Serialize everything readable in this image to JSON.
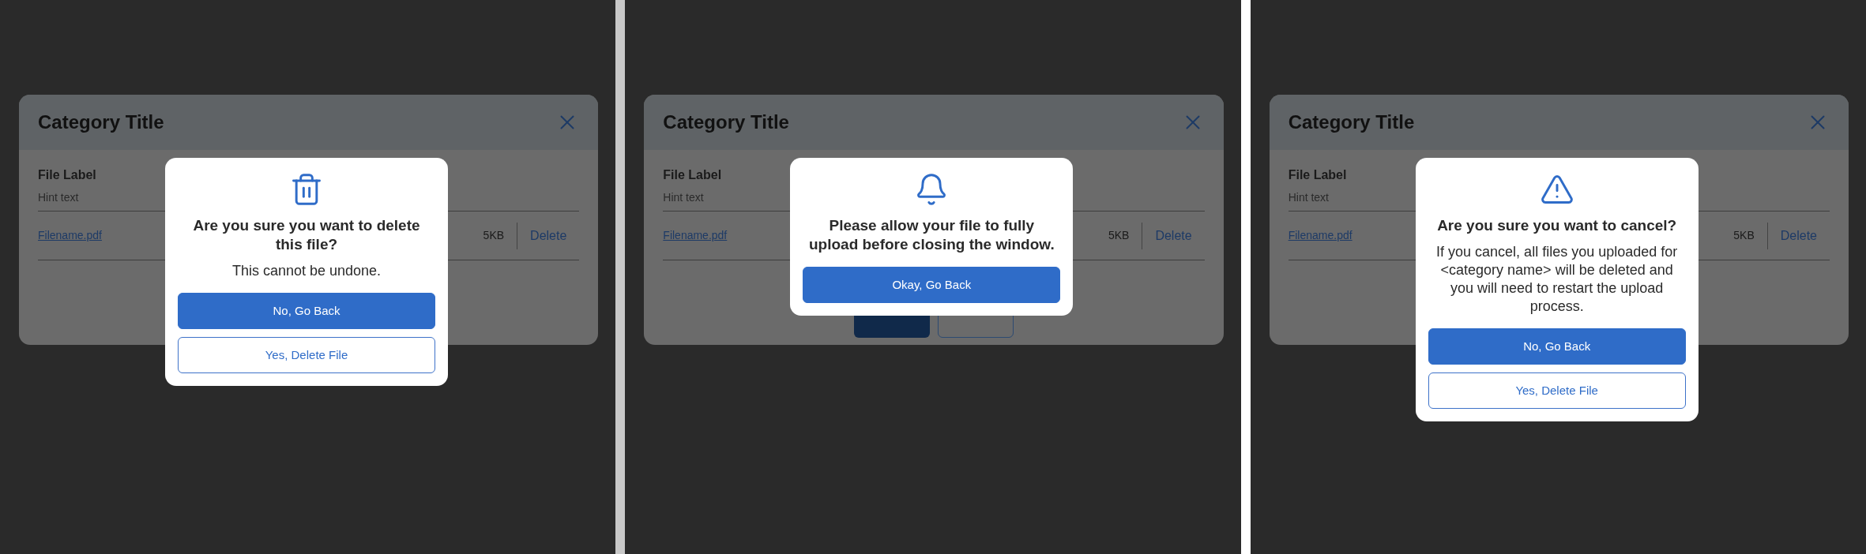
{
  "panels": [
    {
      "background": {
        "title": "Category Title",
        "file_label": "File Label",
        "hint": "Hint text",
        "filename": "Filename.pdf",
        "size": "5KB",
        "delete_label": "Delete"
      },
      "dialog": {
        "kind": "trash",
        "title": "Are you sure you want to delete this file?",
        "body": "This cannot be undone.",
        "buttons": [
          {
            "label": "No, Go Back",
            "kind": "primary"
          },
          {
            "label": "Yes, Delete File",
            "kind": "secondary"
          }
        ]
      }
    },
    {
      "background": {
        "title": "Category Title",
        "file_label": "File Label",
        "hint": "Hint text",
        "filename": "Filename.pdf",
        "size": "5KB",
        "delete_label": "Delete",
        "footer_buttons": [
          {
            "kind": "primary"
          },
          {
            "kind": "secondary"
          }
        ]
      },
      "dialog": {
        "kind": "bell",
        "title": "Please allow your file to fully upload before closing the window.",
        "buttons": [
          {
            "label": "Okay, Go Back",
            "kind": "primary"
          }
        ]
      }
    },
    {
      "background": {
        "title": "Category Title",
        "file_label": "File Label",
        "hint": "Hint text",
        "filename": "Filename.pdf",
        "size": "5KB",
        "delete_label": "Delete"
      },
      "dialog": {
        "kind": "warning",
        "title": "Are you sure you want to cancel?",
        "body": "If you cancel, all files you uploaded for <category name> will be deleted and you will need to restart the upload process.",
        "buttons": [
          {
            "label": "No, Go Back",
            "kind": "primary"
          },
          {
            "label": "Yes, Delete File",
            "kind": "secondary"
          }
        ]
      }
    }
  ]
}
